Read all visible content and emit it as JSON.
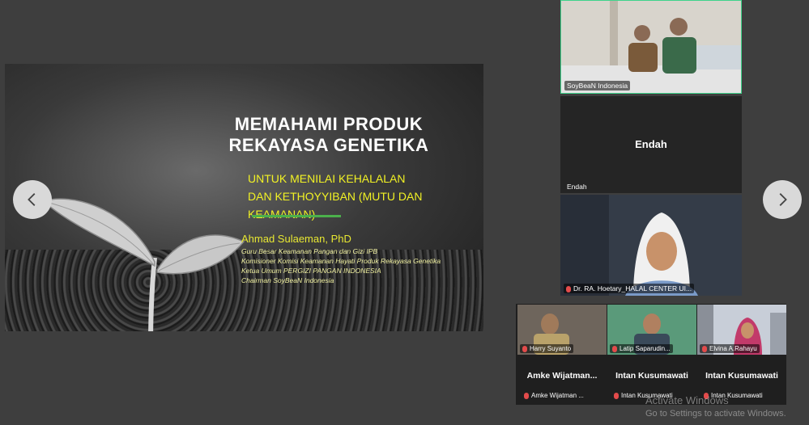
{
  "slide": {
    "title_line1": "MEMAHAMI PRODUK",
    "title_line2": "REKAYASA GENETIKA",
    "subtitle_line1": "UNTUK MENILAI KEHALALAN",
    "subtitle_line2": "DAN KETHOYYIBAN (MUTU DAN",
    "subtitle_line3": "KEAMANAN)",
    "author": "Ahmad Sulaeman, PhD",
    "roles": [
      "Guru Besar Keamanan Pangan dan Gizi IPB",
      "Komisioner Komisi Keamanan Hayati Produk Rekayasa Genetika",
      "Ketua Umum PERGIZI PANGAN INDONESIA",
      "Chairman SoyBeaN Indonesia"
    ]
  },
  "tiles": {
    "top_label": "SoyBeaN Indonesia",
    "endah_big": "Endah",
    "endah_label": "Endah",
    "dr_label": "Dr. RA. Hoetary_HALAL CENTER UI..."
  },
  "strip": {
    "video1_label": "Harry Suyanto",
    "video2_label": "Latip Saparudin...",
    "video3_label": "Elvina A.Rahayu",
    "name1_big": "Amke  Wijatman...",
    "name1_label": "Amke Wijatman ...",
    "name2_big": "Intan Kusumawati",
    "name2_label": "Intan Kusumawati",
    "name3_big": "Intan Kusumawati",
    "name3_label": "Intan Kusumawati"
  },
  "watermark": {
    "line1": "Activate Windows",
    "line2": "Go to Settings to activate Windows."
  },
  "icons": [
    "chevron-left-icon",
    "chevron-right-icon",
    "mic-muted-icon",
    "pin-icon"
  ]
}
